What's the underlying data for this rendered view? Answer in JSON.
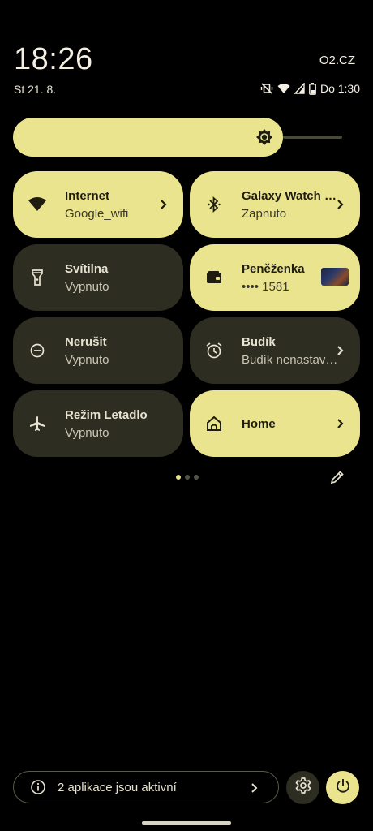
{
  "status_bar": {
    "time": "18:26",
    "carrier": "O2.CZ",
    "date": "St 21. 8.",
    "icons": [
      "vibrate-off-icon",
      "wifi-icon",
      "signal-icon",
      "battery-icon"
    ],
    "battery_text": "Do 1:30"
  },
  "brightness": {
    "icon": "brightness-icon",
    "level_fraction": 0.82
  },
  "tiles": [
    {
      "title": "Internet",
      "subtitle": "Google_wifi",
      "state": "on",
      "icon": "wifi-icon",
      "has_chevron": true
    },
    {
      "title": "Galaxy Watch U...",
      "subtitle": "Zapnuto",
      "state": "on",
      "icon": "bluetooth-icon",
      "has_chevron": true
    },
    {
      "title": "Svítilna",
      "subtitle": "Vypnuto",
      "state": "off",
      "icon": "flashlight-icon",
      "has_chevron": false
    },
    {
      "title": "Peněženka",
      "subtitle": "•••• 1581",
      "state": "on",
      "icon": "wallet-icon",
      "has_chevron": false
    },
    {
      "title": "Nerušit",
      "subtitle": "Vypnuto",
      "state": "off",
      "icon": "do-not-disturb-icon",
      "has_chevron": false
    },
    {
      "title": "Budík",
      "subtitle": "Budík nenastave...",
      "state": "off",
      "icon": "alarm-icon",
      "has_chevron": true
    },
    {
      "title": "Režim Letadlo",
      "subtitle": "Vypnuto",
      "state": "off",
      "icon": "airplane-icon",
      "has_chevron": false
    },
    {
      "title": "Home",
      "subtitle": "",
      "state": "on",
      "icon": "home-icon",
      "has_chevron": true
    }
  ],
  "pager": {
    "pages": 3,
    "active_page": 1
  },
  "edit_icon": "pencil-icon",
  "footer": {
    "active_apps_label": "2 aplikace jsou aktivní",
    "settings_icon": "gear-icon",
    "power_icon": "power-icon"
  },
  "colors": {
    "accent": "#ebe48f",
    "tile_off": "#2e2d22",
    "background": "#000000"
  }
}
